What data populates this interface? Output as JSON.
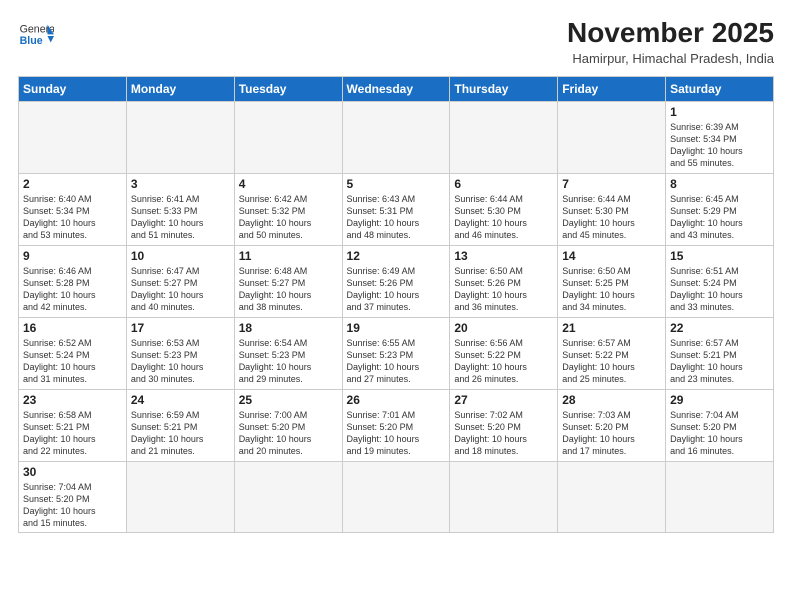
{
  "header": {
    "logo_general": "General",
    "logo_blue": "Blue",
    "month_year": "November 2025",
    "location": "Hamirpur, Himachal Pradesh, India"
  },
  "weekdays": [
    "Sunday",
    "Monday",
    "Tuesday",
    "Wednesday",
    "Thursday",
    "Friday",
    "Saturday"
  ],
  "weeks": [
    [
      {
        "day": "",
        "info": ""
      },
      {
        "day": "",
        "info": ""
      },
      {
        "day": "",
        "info": ""
      },
      {
        "day": "",
        "info": ""
      },
      {
        "day": "",
        "info": ""
      },
      {
        "day": "",
        "info": ""
      },
      {
        "day": "1",
        "info": "Sunrise: 6:39 AM\nSunset: 5:34 PM\nDaylight: 10 hours\nand 55 minutes."
      }
    ],
    [
      {
        "day": "2",
        "info": "Sunrise: 6:40 AM\nSunset: 5:34 PM\nDaylight: 10 hours\nand 53 minutes."
      },
      {
        "day": "3",
        "info": "Sunrise: 6:41 AM\nSunset: 5:33 PM\nDaylight: 10 hours\nand 51 minutes."
      },
      {
        "day": "4",
        "info": "Sunrise: 6:42 AM\nSunset: 5:32 PM\nDaylight: 10 hours\nand 50 minutes."
      },
      {
        "day": "5",
        "info": "Sunrise: 6:43 AM\nSunset: 5:31 PM\nDaylight: 10 hours\nand 48 minutes."
      },
      {
        "day": "6",
        "info": "Sunrise: 6:44 AM\nSunset: 5:30 PM\nDaylight: 10 hours\nand 46 minutes."
      },
      {
        "day": "7",
        "info": "Sunrise: 6:44 AM\nSunset: 5:30 PM\nDaylight: 10 hours\nand 45 minutes."
      },
      {
        "day": "8",
        "info": "Sunrise: 6:45 AM\nSunset: 5:29 PM\nDaylight: 10 hours\nand 43 minutes."
      }
    ],
    [
      {
        "day": "9",
        "info": "Sunrise: 6:46 AM\nSunset: 5:28 PM\nDaylight: 10 hours\nand 42 minutes."
      },
      {
        "day": "10",
        "info": "Sunrise: 6:47 AM\nSunset: 5:27 PM\nDaylight: 10 hours\nand 40 minutes."
      },
      {
        "day": "11",
        "info": "Sunrise: 6:48 AM\nSunset: 5:27 PM\nDaylight: 10 hours\nand 38 minutes."
      },
      {
        "day": "12",
        "info": "Sunrise: 6:49 AM\nSunset: 5:26 PM\nDaylight: 10 hours\nand 37 minutes."
      },
      {
        "day": "13",
        "info": "Sunrise: 6:50 AM\nSunset: 5:26 PM\nDaylight: 10 hours\nand 36 minutes."
      },
      {
        "day": "14",
        "info": "Sunrise: 6:50 AM\nSunset: 5:25 PM\nDaylight: 10 hours\nand 34 minutes."
      },
      {
        "day": "15",
        "info": "Sunrise: 6:51 AM\nSunset: 5:24 PM\nDaylight: 10 hours\nand 33 minutes."
      }
    ],
    [
      {
        "day": "16",
        "info": "Sunrise: 6:52 AM\nSunset: 5:24 PM\nDaylight: 10 hours\nand 31 minutes."
      },
      {
        "day": "17",
        "info": "Sunrise: 6:53 AM\nSunset: 5:23 PM\nDaylight: 10 hours\nand 30 minutes."
      },
      {
        "day": "18",
        "info": "Sunrise: 6:54 AM\nSunset: 5:23 PM\nDaylight: 10 hours\nand 29 minutes."
      },
      {
        "day": "19",
        "info": "Sunrise: 6:55 AM\nSunset: 5:23 PM\nDaylight: 10 hours\nand 27 minutes."
      },
      {
        "day": "20",
        "info": "Sunrise: 6:56 AM\nSunset: 5:22 PM\nDaylight: 10 hours\nand 26 minutes."
      },
      {
        "day": "21",
        "info": "Sunrise: 6:57 AM\nSunset: 5:22 PM\nDaylight: 10 hours\nand 25 minutes."
      },
      {
        "day": "22",
        "info": "Sunrise: 6:57 AM\nSunset: 5:21 PM\nDaylight: 10 hours\nand 23 minutes."
      }
    ],
    [
      {
        "day": "23",
        "info": "Sunrise: 6:58 AM\nSunset: 5:21 PM\nDaylight: 10 hours\nand 22 minutes."
      },
      {
        "day": "24",
        "info": "Sunrise: 6:59 AM\nSunset: 5:21 PM\nDaylight: 10 hours\nand 21 minutes."
      },
      {
        "day": "25",
        "info": "Sunrise: 7:00 AM\nSunset: 5:20 PM\nDaylight: 10 hours\nand 20 minutes."
      },
      {
        "day": "26",
        "info": "Sunrise: 7:01 AM\nSunset: 5:20 PM\nDaylight: 10 hours\nand 19 minutes."
      },
      {
        "day": "27",
        "info": "Sunrise: 7:02 AM\nSunset: 5:20 PM\nDaylight: 10 hours\nand 18 minutes."
      },
      {
        "day": "28",
        "info": "Sunrise: 7:03 AM\nSunset: 5:20 PM\nDaylight: 10 hours\nand 17 minutes."
      },
      {
        "day": "29",
        "info": "Sunrise: 7:04 AM\nSunset: 5:20 PM\nDaylight: 10 hours\nand 16 minutes."
      }
    ],
    [
      {
        "day": "30",
        "info": "Sunrise: 7:04 AM\nSunset: 5:20 PM\nDaylight: 10 hours\nand 15 minutes."
      },
      {
        "day": "",
        "info": ""
      },
      {
        "day": "",
        "info": ""
      },
      {
        "day": "",
        "info": ""
      },
      {
        "day": "",
        "info": ""
      },
      {
        "day": "",
        "info": ""
      },
      {
        "day": "",
        "info": ""
      }
    ]
  ]
}
